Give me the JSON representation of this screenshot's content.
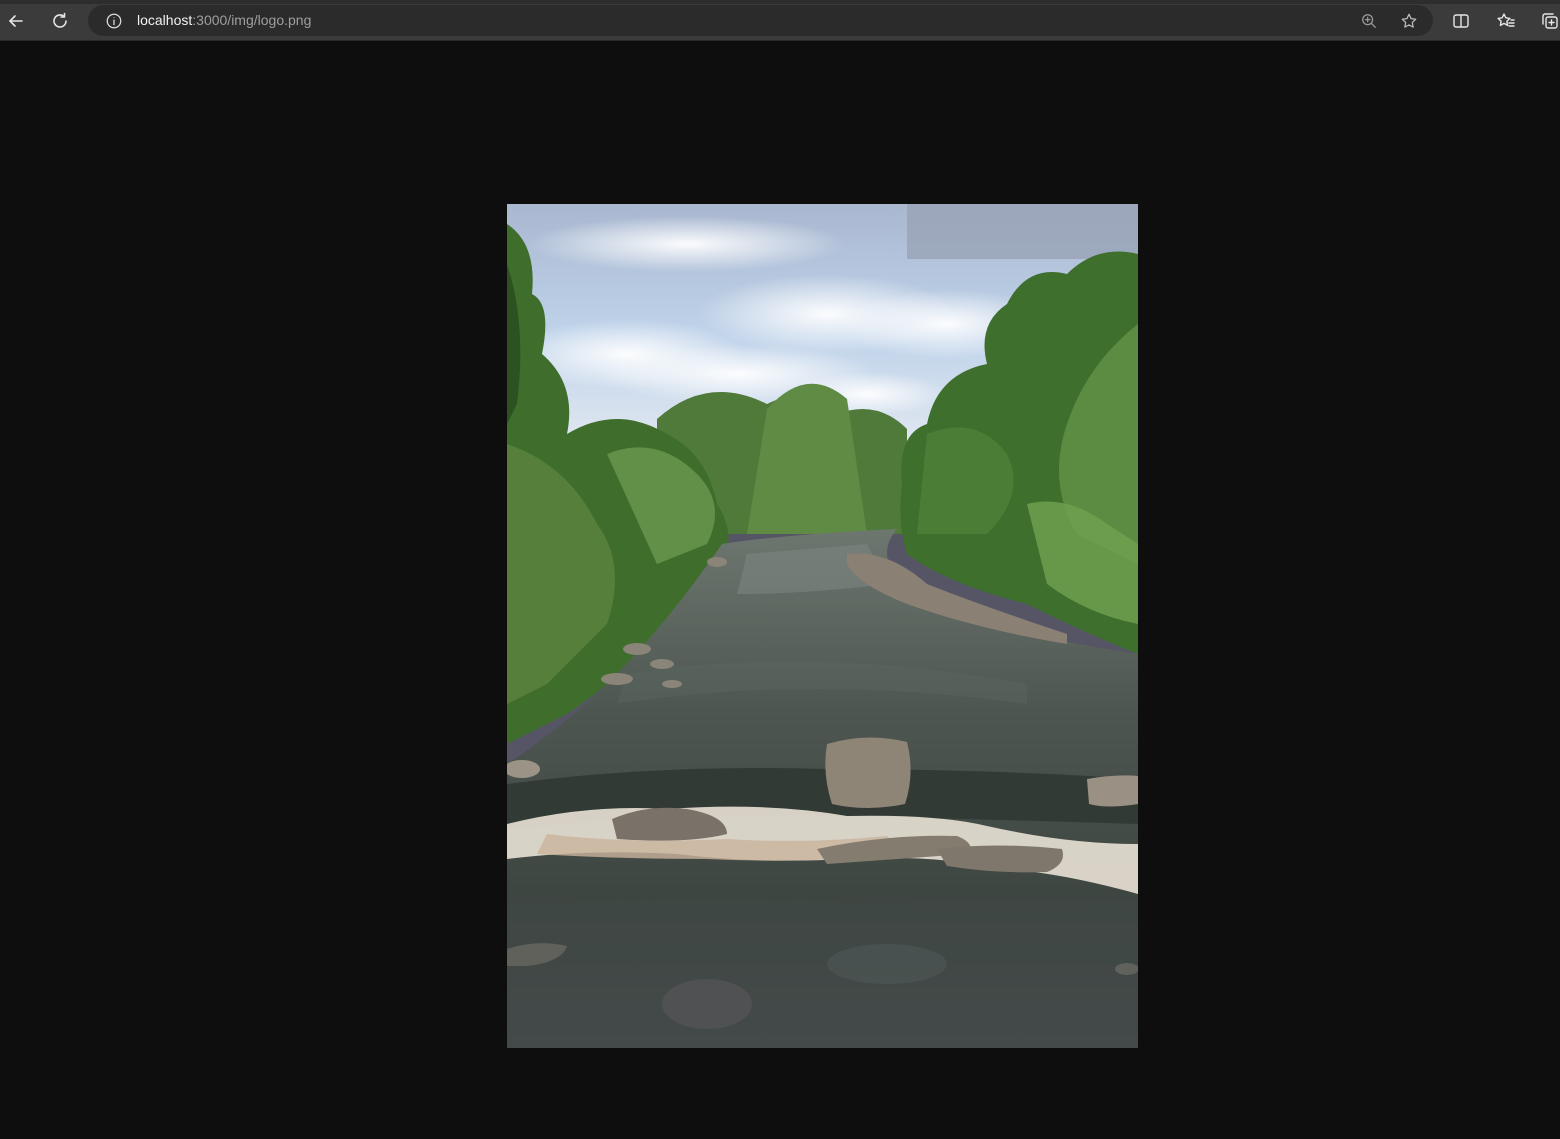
{
  "browser": {
    "url_host": "localhost",
    "url_path": ":3000/img/logo.png",
    "icons": {
      "back": "back-arrow-icon",
      "refresh": "refresh-icon",
      "site_info": "info-icon",
      "zoom": "zoom-in-icon",
      "favorite": "star-icon",
      "split_screen": "split-screen-icon",
      "favorites": "favorites-icon",
      "collections": "collections-icon"
    }
  },
  "viewer": {
    "background": "#0e0e0e",
    "image_subject": "river-landscape"
  }
}
